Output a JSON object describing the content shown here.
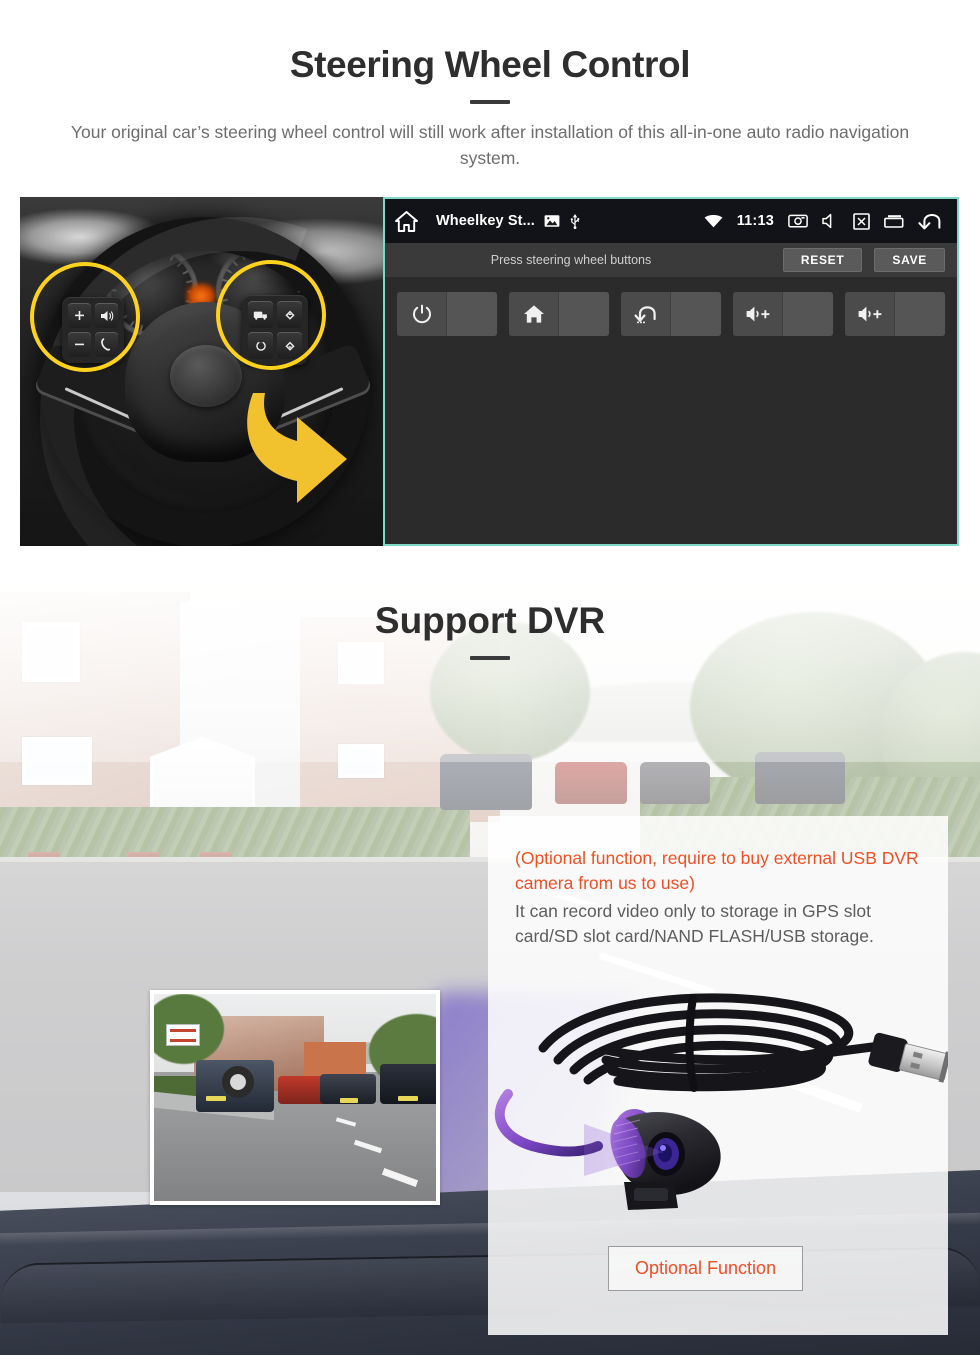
{
  "sections": [
    {
      "id": "steering-wheel-control",
      "title": "Steering Wheel Control",
      "subtitle": "Your original car’s steering wheel control will still work after installation of this all-in-one auto radio navigation system."
    },
    {
      "id": "support-dvr",
      "title": "Support DVR"
    }
  ],
  "android_panel": {
    "status_bar": {
      "home_icon": "home-icon",
      "app_title": "Wheelkey St...",
      "image_icon": "image-icon",
      "usb_icon": "usb-icon",
      "wifi_icon": "wifi-icon",
      "time": "11:13",
      "screenshot_icon": "screenshot-camera-icon",
      "mute_icon": "mute-speaker-icon",
      "screen_off_icon": "screen-off-icon",
      "recents_icon": "recents-icon",
      "back_icon": "back-arrow-icon"
    },
    "action_bar": {
      "hint": "Press steering wheel buttons",
      "reset_label": "RESET",
      "save_label": "SAVE"
    },
    "keys": [
      {
        "icon": "power-icon",
        "label": ""
      },
      {
        "icon": "home-icon",
        "label": ""
      },
      {
        "icon": "back-icon",
        "label": ""
      },
      {
        "icon": "volume-up-icon",
        "label": ""
      },
      {
        "icon": "volume-up-icon",
        "label": ""
      }
    ],
    "accent_border": "#7fd8c8"
  },
  "steering_photo": {
    "left_cluster_keys": [
      "volume-up-plus",
      "voice-command",
      "volume-down-minus",
      "phone-call"
    ],
    "right_cluster_keys": [
      "media-source",
      "up-arrow",
      "mode-circle",
      "down-arrow"
    ],
    "highlight_color": "#FFD21E",
    "arrow_color": "#F2C12E"
  },
  "dvr_card": {
    "note_red": "(Optional function, require to buy external USB DVR camera from us to use)",
    "note_grey": "It can record video only to storage in GPS slot card/SD slot card/NAND FLASH/USB storage.",
    "button_label": "Optional Function",
    "red_color": "#F04E23",
    "grey_color": "#5d5d5d"
  }
}
